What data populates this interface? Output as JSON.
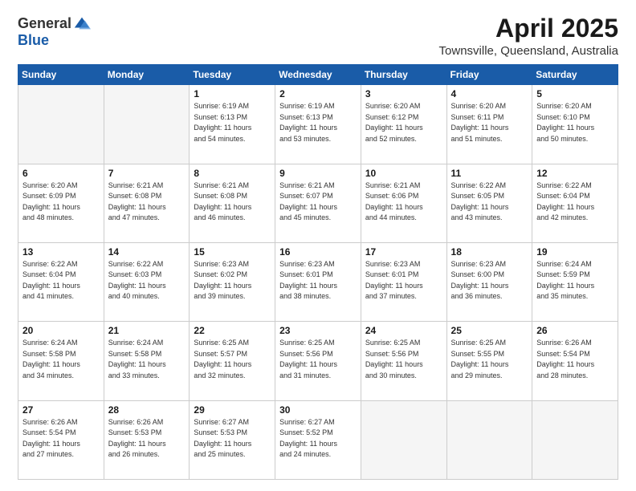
{
  "header": {
    "logo_general": "General",
    "logo_blue": "Blue",
    "month_title": "April 2025",
    "location": "Townsville, Queensland, Australia"
  },
  "calendar": {
    "days_of_week": [
      "Sunday",
      "Monday",
      "Tuesday",
      "Wednesday",
      "Thursday",
      "Friday",
      "Saturday"
    ],
    "weeks": [
      [
        {
          "day": "",
          "info": ""
        },
        {
          "day": "",
          "info": ""
        },
        {
          "day": "1",
          "info": "Sunrise: 6:19 AM\nSunset: 6:13 PM\nDaylight: 11 hours\nand 54 minutes."
        },
        {
          "day": "2",
          "info": "Sunrise: 6:19 AM\nSunset: 6:13 PM\nDaylight: 11 hours\nand 53 minutes."
        },
        {
          "day": "3",
          "info": "Sunrise: 6:20 AM\nSunset: 6:12 PM\nDaylight: 11 hours\nand 52 minutes."
        },
        {
          "day": "4",
          "info": "Sunrise: 6:20 AM\nSunset: 6:11 PM\nDaylight: 11 hours\nand 51 minutes."
        },
        {
          "day": "5",
          "info": "Sunrise: 6:20 AM\nSunset: 6:10 PM\nDaylight: 11 hours\nand 50 minutes."
        }
      ],
      [
        {
          "day": "6",
          "info": "Sunrise: 6:20 AM\nSunset: 6:09 PM\nDaylight: 11 hours\nand 48 minutes."
        },
        {
          "day": "7",
          "info": "Sunrise: 6:21 AM\nSunset: 6:08 PM\nDaylight: 11 hours\nand 47 minutes."
        },
        {
          "day": "8",
          "info": "Sunrise: 6:21 AM\nSunset: 6:08 PM\nDaylight: 11 hours\nand 46 minutes."
        },
        {
          "day": "9",
          "info": "Sunrise: 6:21 AM\nSunset: 6:07 PM\nDaylight: 11 hours\nand 45 minutes."
        },
        {
          "day": "10",
          "info": "Sunrise: 6:21 AM\nSunset: 6:06 PM\nDaylight: 11 hours\nand 44 minutes."
        },
        {
          "day": "11",
          "info": "Sunrise: 6:22 AM\nSunset: 6:05 PM\nDaylight: 11 hours\nand 43 minutes."
        },
        {
          "day": "12",
          "info": "Sunrise: 6:22 AM\nSunset: 6:04 PM\nDaylight: 11 hours\nand 42 minutes."
        }
      ],
      [
        {
          "day": "13",
          "info": "Sunrise: 6:22 AM\nSunset: 6:04 PM\nDaylight: 11 hours\nand 41 minutes."
        },
        {
          "day": "14",
          "info": "Sunrise: 6:22 AM\nSunset: 6:03 PM\nDaylight: 11 hours\nand 40 minutes."
        },
        {
          "day": "15",
          "info": "Sunrise: 6:23 AM\nSunset: 6:02 PM\nDaylight: 11 hours\nand 39 minutes."
        },
        {
          "day": "16",
          "info": "Sunrise: 6:23 AM\nSunset: 6:01 PM\nDaylight: 11 hours\nand 38 minutes."
        },
        {
          "day": "17",
          "info": "Sunrise: 6:23 AM\nSunset: 6:01 PM\nDaylight: 11 hours\nand 37 minutes."
        },
        {
          "day": "18",
          "info": "Sunrise: 6:23 AM\nSunset: 6:00 PM\nDaylight: 11 hours\nand 36 minutes."
        },
        {
          "day": "19",
          "info": "Sunrise: 6:24 AM\nSunset: 5:59 PM\nDaylight: 11 hours\nand 35 minutes."
        }
      ],
      [
        {
          "day": "20",
          "info": "Sunrise: 6:24 AM\nSunset: 5:58 PM\nDaylight: 11 hours\nand 34 minutes."
        },
        {
          "day": "21",
          "info": "Sunrise: 6:24 AM\nSunset: 5:58 PM\nDaylight: 11 hours\nand 33 minutes."
        },
        {
          "day": "22",
          "info": "Sunrise: 6:25 AM\nSunset: 5:57 PM\nDaylight: 11 hours\nand 32 minutes."
        },
        {
          "day": "23",
          "info": "Sunrise: 6:25 AM\nSunset: 5:56 PM\nDaylight: 11 hours\nand 31 minutes."
        },
        {
          "day": "24",
          "info": "Sunrise: 6:25 AM\nSunset: 5:56 PM\nDaylight: 11 hours\nand 30 minutes."
        },
        {
          "day": "25",
          "info": "Sunrise: 6:25 AM\nSunset: 5:55 PM\nDaylight: 11 hours\nand 29 minutes."
        },
        {
          "day": "26",
          "info": "Sunrise: 6:26 AM\nSunset: 5:54 PM\nDaylight: 11 hours\nand 28 minutes."
        }
      ],
      [
        {
          "day": "27",
          "info": "Sunrise: 6:26 AM\nSunset: 5:54 PM\nDaylight: 11 hours\nand 27 minutes."
        },
        {
          "day": "28",
          "info": "Sunrise: 6:26 AM\nSunset: 5:53 PM\nDaylight: 11 hours\nand 26 minutes."
        },
        {
          "day": "29",
          "info": "Sunrise: 6:27 AM\nSunset: 5:53 PM\nDaylight: 11 hours\nand 25 minutes."
        },
        {
          "day": "30",
          "info": "Sunrise: 6:27 AM\nSunset: 5:52 PM\nDaylight: 11 hours\nand 24 minutes."
        },
        {
          "day": "",
          "info": ""
        },
        {
          "day": "",
          "info": ""
        },
        {
          "day": "",
          "info": ""
        }
      ]
    ]
  }
}
